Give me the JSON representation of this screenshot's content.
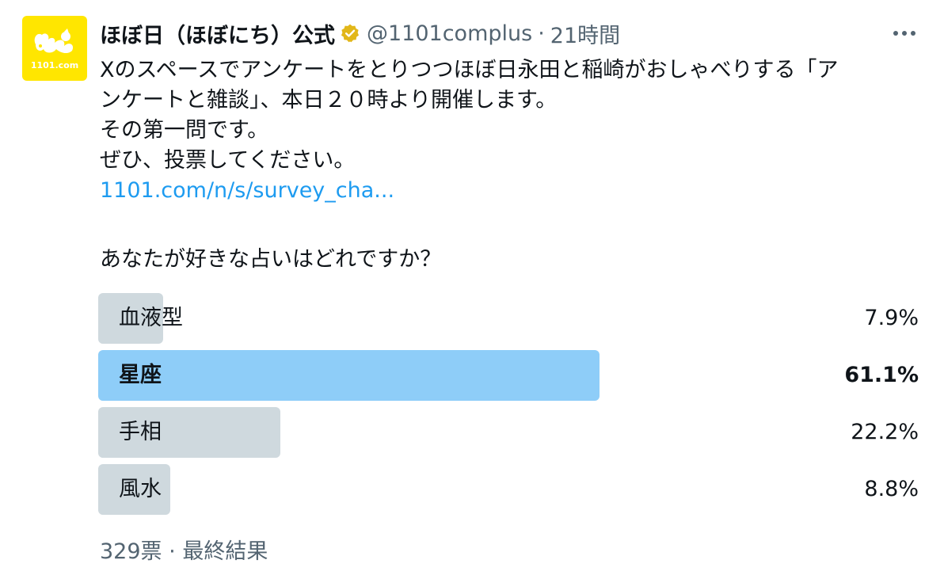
{
  "tweet": {
    "author": {
      "display_name": "ほぼ日（ほぼにち）公式",
      "handle": "@1101complus",
      "avatar_text": "1101.com",
      "verified_icon": "verified-badge-icon",
      "verified_color": "#e2b719"
    },
    "separator": "·",
    "time": "21時間",
    "more_icon": "more-options-icon",
    "body_lines": [
      "Xのスペースでアンケートをとりつつほぼ日永田と稲崎がおしゃべりする「ア",
      "ンケートと雑談」、本日２０時より開催します。",
      "その第一問です。",
      "ぜひ、投票してください。"
    ],
    "link_text": "1101.com/n/s/survey_cha...",
    "link_color": "#1d9bf0"
  },
  "poll": {
    "question": "あなたが好きな占いはどれですか？",
    "options": [
      {
        "label": "血液型",
        "percent_text": "7.9%",
        "percent": 7.9
      },
      {
        "label": "星座",
        "percent_text": "61.1%",
        "percent": 61.1,
        "winner": true
      },
      {
        "label": "手相",
        "percent_text": "22.2%",
        "percent": 22.2
      },
      {
        "label": "風水",
        "percent_text": "8.8%",
        "percent": 8.8
      }
    ],
    "votes_text": "329票",
    "separator": "·",
    "status_text": "最終結果",
    "bar_color": "#cfd9de",
    "winner_bar_color": "#8ecdf8"
  }
}
